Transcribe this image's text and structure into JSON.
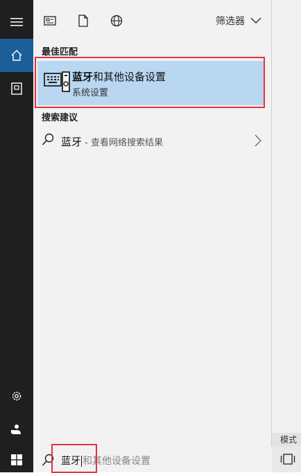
{
  "desktop": {
    "mode_label": "模式"
  },
  "panel": {
    "filter_label": "筛选器",
    "best_match": {
      "section": "最佳匹配",
      "title_bold": "蓝牙",
      "title_rest": "和其他设备设置",
      "subtitle": "系统设置"
    },
    "suggestions": {
      "section": "搜索建议",
      "items": [
        {
          "query": "蓝牙",
          "description": " - 查看网络搜索结果"
        }
      ]
    }
  },
  "taskbar": {
    "search_typed": "蓝牙",
    "search_hint": "和其他设备设置"
  },
  "colors": {
    "accent": "#1a5f99",
    "selection": "#b9d7f1",
    "highlight_box": "#e0323c",
    "rail": "#1f1f1f"
  },
  "icons": [
    "menu-icon",
    "home-icon",
    "documents-icon",
    "settings-icon",
    "user-icon",
    "windows-icon",
    "apps-icon",
    "document-icon",
    "web-icon",
    "chevron-down-icon",
    "device-icon",
    "search-icon",
    "chevron-right-icon",
    "task-view-icon"
  ]
}
